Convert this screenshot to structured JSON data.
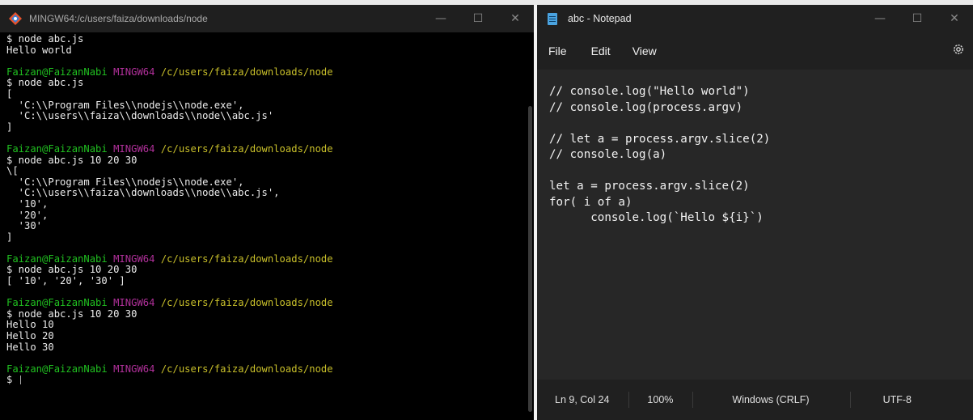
{
  "terminal": {
    "title": "MINGW64:/c/users/faiza/downloads/node",
    "controls": {
      "minimize": "—",
      "maximize": "☐",
      "close": "✕"
    },
    "lines": [
      {
        "type": "plain",
        "text": "$ node abc.js"
      },
      {
        "type": "plain",
        "text": "Hello world"
      },
      {
        "type": "blank",
        "text": ""
      },
      {
        "type": "prompt",
        "user": "Faizan@FaizanNabi",
        "sys": "MINGW64",
        "path": "/c/users/faiza/downloads/node"
      },
      {
        "type": "plain",
        "text": "$ node abc.js"
      },
      {
        "type": "plain",
        "text": "["
      },
      {
        "type": "plain",
        "text": "  'C:\\\\Program Files\\\\nodejs\\\\node.exe',"
      },
      {
        "type": "plain",
        "text": "  'C:\\\\users\\\\faiza\\\\downloads\\\\node\\\\abc.js'"
      },
      {
        "type": "plain",
        "text": "]"
      },
      {
        "type": "blank",
        "text": ""
      },
      {
        "type": "prompt",
        "user": "Faizan@FaizanNabi",
        "sys": "MINGW64",
        "path": "/c/users/faiza/downloads/node"
      },
      {
        "type": "plain",
        "text": "$ node abc.js 10 20 30"
      },
      {
        "type": "plain",
        "text": "\\["
      },
      {
        "type": "plain",
        "text": "  'C:\\\\Program Files\\\\nodejs\\\\node.exe',"
      },
      {
        "type": "plain",
        "text": "  'C:\\\\users\\\\faiza\\\\downloads\\\\node\\\\abc.js',"
      },
      {
        "type": "plain",
        "text": "  '10',"
      },
      {
        "type": "plain",
        "text": "  '20',"
      },
      {
        "type": "plain",
        "text": "  '30'"
      },
      {
        "type": "plain",
        "text": "]"
      },
      {
        "type": "blank",
        "text": ""
      },
      {
        "type": "prompt",
        "user": "Faizan@FaizanNabi",
        "sys": "MINGW64",
        "path": "/c/users/faiza/downloads/node"
      },
      {
        "type": "plain",
        "text": "$ node abc.js 10 20 30"
      },
      {
        "type": "plain",
        "text": "[ '10', '20', '30' ]"
      },
      {
        "type": "blank",
        "text": ""
      },
      {
        "type": "prompt",
        "user": "Faizan@FaizanNabi",
        "sys": "MINGW64",
        "path": "/c/users/faiza/downloads/node"
      },
      {
        "type": "plain",
        "text": "$ node abc.js 10 20 30"
      },
      {
        "type": "plain",
        "text": "Hello 10"
      },
      {
        "type": "plain",
        "text": "Hello 20"
      },
      {
        "type": "plain",
        "text": "Hello 30"
      },
      {
        "type": "blank",
        "text": ""
      },
      {
        "type": "prompt",
        "user": "Faizan@FaizanNabi",
        "sys": "MINGW64",
        "path": "/c/users/faiza/downloads/node"
      },
      {
        "type": "input",
        "text": "$ "
      }
    ],
    "colors": {
      "background": "#000000",
      "user": "#20c020",
      "system": "#b0309a",
      "path": "#c8bf2a",
      "text": "#ececec"
    }
  },
  "notepad": {
    "title": "abc - Notepad",
    "controls": {
      "minimize": "—",
      "maximize": "☐",
      "close": "✕"
    },
    "menu": [
      "File",
      "Edit",
      "View"
    ],
    "code_lines": [
      "// console.log(\"Hello world\")",
      "// console.log(process.argv)",
      "",
      "// let a = process.argv.slice(2)",
      "// console.log(a)",
      "",
      "let a = process.argv.slice(2)",
      "for( i of a)",
      "      console.log(`Hello ${i}`)"
    ],
    "status": {
      "position": "Ln 9, Col 24",
      "zoom": "100%",
      "line_ending": "Windows (CRLF)",
      "encoding": "UTF-8"
    }
  }
}
